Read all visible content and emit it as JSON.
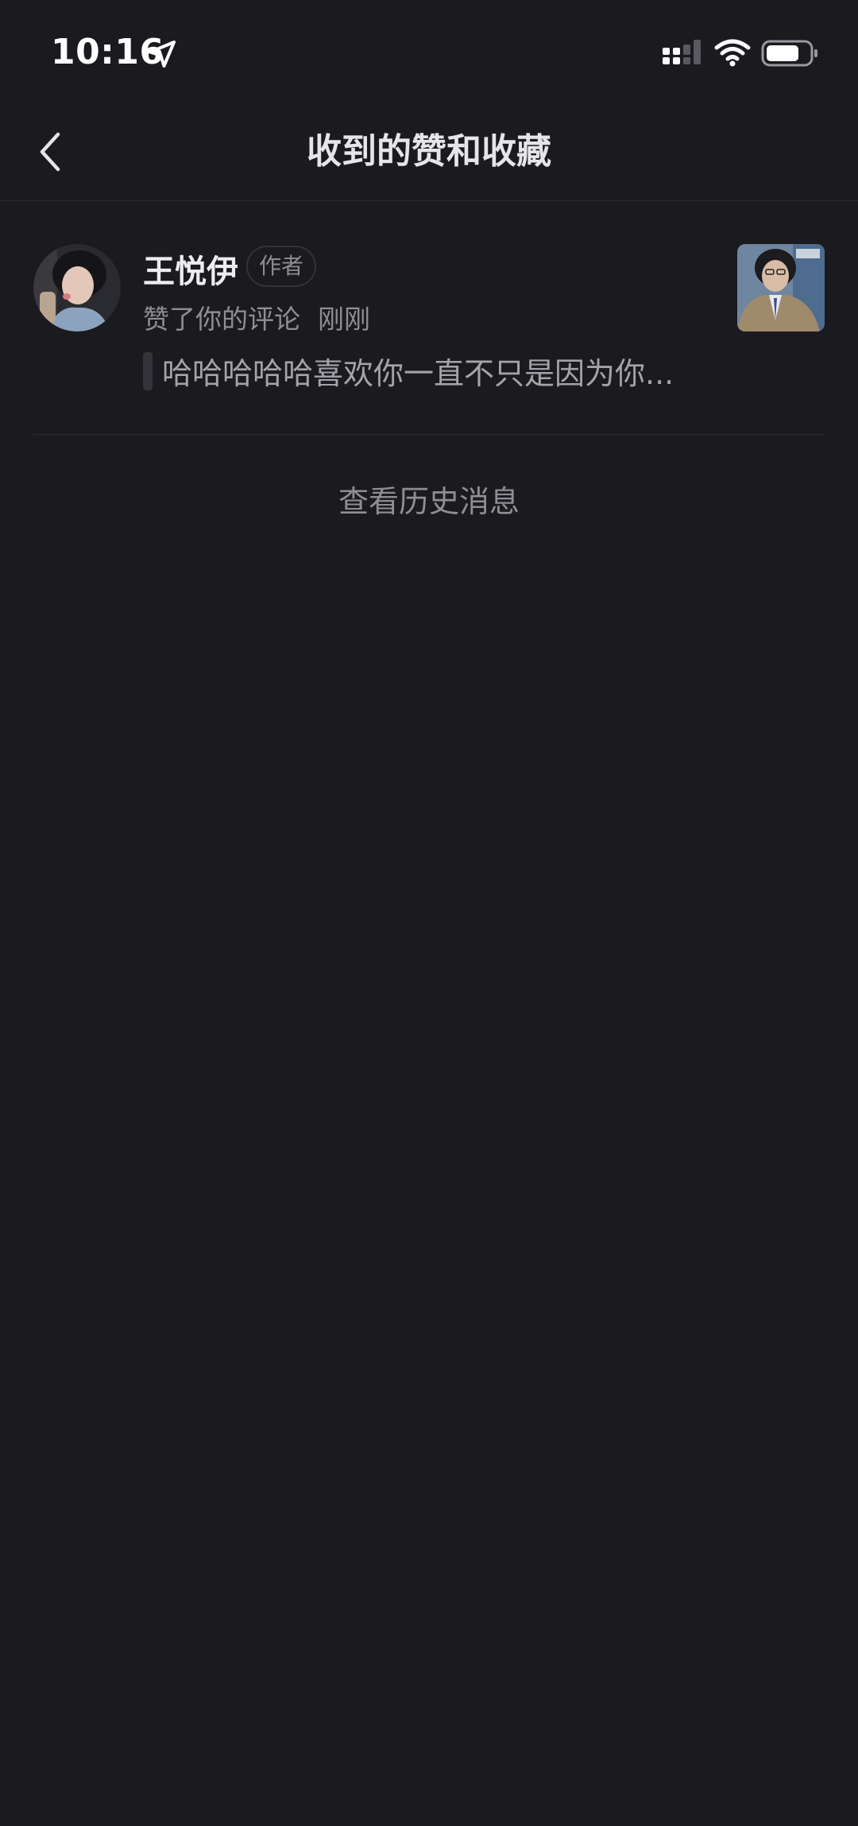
{
  "status_bar": {
    "time": "10:16",
    "icons": [
      "location-arrow-icon",
      "cellular-signal-icon",
      "wifi-icon",
      "battery-icon"
    ]
  },
  "nav": {
    "title": "收到的赞和收藏",
    "back_icon": "chevron-left-icon"
  },
  "notifications": [
    {
      "user_name": "王悦伊",
      "badge": "作者",
      "action": "赞了你的评论",
      "time": "刚刚",
      "quote": "哈哈哈哈哈喜欢你一直不只是因为你..."
    }
  ],
  "history_link": "查看历史消息",
  "colors": {
    "background": "#1b1a1f",
    "primary_text": "#e6e6e8",
    "secondary_text": "#8f8e94",
    "divider": "#2c2b31"
  }
}
